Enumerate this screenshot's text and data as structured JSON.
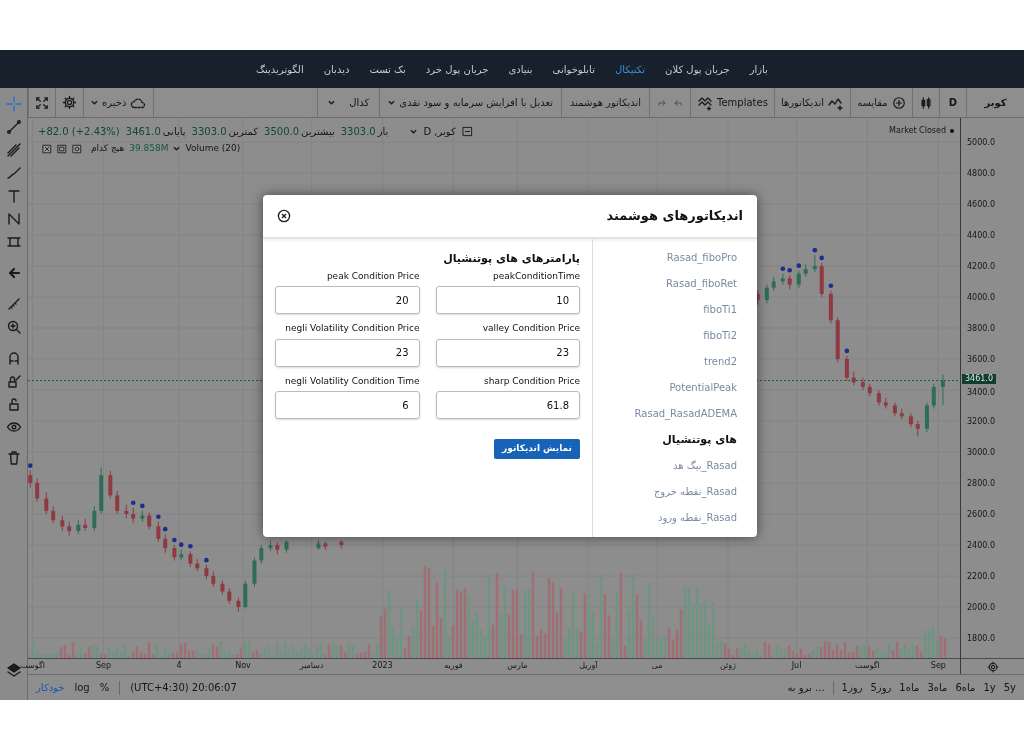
{
  "nav": [
    {
      "label": "بازار",
      "selected": false
    },
    {
      "label": "جریان پول کلان",
      "selected": false
    },
    {
      "label": "تکنیکال",
      "selected": true
    },
    {
      "label": "تابلوخوانی",
      "selected": false
    },
    {
      "label": "بنیادی",
      "selected": false
    },
    {
      "label": "جریان پول خرد",
      "selected": false
    },
    {
      "label": "بک تست",
      "selected": false
    },
    {
      "label": "دیدبان",
      "selected": false
    },
    {
      "label": "الگوتریدینگ",
      "selected": false
    }
  ],
  "tools": [
    {
      "kind": "crosshair",
      "selected": true
    },
    {
      "kind": "line",
      "selected": false
    },
    {
      "kind": "fork",
      "selected": false
    },
    {
      "kind": "brush",
      "selected": false
    },
    {
      "kind": "text",
      "selected": false
    },
    {
      "kind": "nodes",
      "selected": false
    },
    {
      "kind": "measure",
      "selected": false
    },
    {
      "kind": "arrow",
      "selected": false
    },
    {
      "kind": "ruler",
      "selected": false
    },
    {
      "kind": "zoom",
      "selected": false
    },
    {
      "kind": "magnet",
      "selected": false
    },
    {
      "kind": "lockpencil",
      "selected": false
    },
    {
      "kind": "lock",
      "selected": false
    },
    {
      "kind": "eye",
      "selected": false
    },
    {
      "kind": "trash",
      "selected": false
    }
  ],
  "toolbar": {
    "symbol": "کوبر",
    "interval": "D",
    "compare": "مقایسه",
    "indicators": "اندیکاتورها",
    "templates": "Templates",
    "smart_indicator": "اندیکاتور هوشمند",
    "adjustment": "تعدیل با افزایش سرمایه و سود نقدی",
    "codal": "کدال",
    "save": "ذخیره"
  },
  "legend": {
    "symbol": "کوبر, D",
    "stats": [
      {
        "label": "باز",
        "value": "3303.0"
      },
      {
        "label": "بیشترین",
        "value": "3500.0"
      },
      {
        "label": "کمترین",
        "value": "3303.0"
      },
      {
        "label": "پایانی",
        "value": "3461.0"
      }
    ],
    "change": "+82.0 (+2.43%)",
    "volume_label": "Volume (20)",
    "volume_value": "39.858M",
    "volume_ma": "هیچ کدام",
    "market_status": "Market Closed"
  },
  "chart_data": {
    "type": "candlestick",
    "grid": true,
    "x": [
      "2022-07-31",
      "2022-08-03",
      "2022-08-07",
      "2022-08-10",
      "2022-08-14",
      "2022-08-17",
      "2022-08-21",
      "2022-08-24",
      "2022-08-28",
      "2022-08-31",
      "2022-09-04",
      "2022-09-07",
      "2022-09-11",
      "2022-09-14",
      "2022-09-18",
      "2022-09-21",
      "2022-09-25",
      "2022-09-28",
      "2022-10-02",
      "2022-10-05",
      "2022-10-09",
      "2022-10-12",
      "2022-10-16",
      "2022-10-19",
      "2022-10-23",
      "2022-10-26",
      "2022-10-30",
      "2022-11-02",
      "2022-11-06",
      "2022-11-09",
      "2022-11-13",
      "2022-11-16",
      "2022-11-20",
      "2022-12-04",
      "2022-12-07",
      "2022-12-14",
      "2023-06-14",
      "2023-06-18",
      "2023-06-21",
      "2023-06-25",
      "2023-06-28",
      "2023-07-02",
      "2023-07-05",
      "2023-07-09",
      "2023-07-12",
      "2023-07-16",
      "2023-07-19",
      "2023-07-23",
      "2023-07-26",
      "2023-07-30",
      "2023-08-02",
      "2023-08-06",
      "2023-08-09",
      "2023-08-13",
      "2023-08-16",
      "2023-08-20",
      "2023-08-23",
      "2023-08-27",
      "2023-08-30",
      "2023-09-03"
    ],
    "ohlc": [
      [
        2850,
        2880,
        2770,
        2800
      ],
      [
        2800,
        2830,
        2680,
        2700
      ],
      [
        2700,
        2740,
        2600,
        2620
      ],
      [
        2620,
        2650,
        2540,
        2560
      ],
      [
        2560,
        2590,
        2490,
        2520
      ],
      [
        2520,
        2550,
        2460,
        2490
      ],
      [
        2490,
        2560,
        2470,
        2530
      ],
      [
        2530,
        2570,
        2490,
        2510
      ],
      [
        2510,
        2650,
        2490,
        2620
      ],
      [
        2620,
        2900,
        2600,
        2850
      ],
      [
        2850,
        2880,
        2700,
        2720
      ],
      [
        2720,
        2750,
        2600,
        2620
      ],
      [
        2620,
        2660,
        2570,
        2600
      ],
      [
        2600,
        2640,
        2540,
        2570
      ],
      [
        2570,
        2620,
        2550,
        2590
      ],
      [
        2590,
        2610,
        2500,
        2520
      ],
      [
        2520,
        2550,
        2420,
        2440
      ],
      [
        2440,
        2470,
        2350,
        2380
      ],
      [
        2380,
        2400,
        2300,
        2320
      ],
      [
        2320,
        2370,
        2300,
        2340
      ],
      [
        2340,
        2360,
        2260,
        2280
      ],
      [
        2280,
        2310,
        2230,
        2250
      ],
      [
        2250,
        2270,
        2180,
        2200
      ],
      [
        2200,
        2230,
        2130,
        2150
      ],
      [
        2150,
        2170,
        2080,
        2100
      ],
      [
        2100,
        2120,
        2020,
        2040
      ],
      [
        2040,
        2060,
        1970,
        2000
      ],
      [
        2000,
        2170,
        1990,
        2150
      ],
      [
        2150,
        2320,
        2130,
        2300
      ],
      [
        2300,
        2400,
        2280,
        2380
      ],
      [
        2380,
        2430,
        2360,
        2400
      ],
      [
        2400,
        2420,
        2340,
        2370
      ],
      [
        2370,
        2430,
        2350,
        2420
      ],
      [
        2380,
        2430,
        2370,
        2410
      ],
      [
        2410,
        2420,
        2370,
        2390
      ],
      [
        2420,
        2430,
        2380,
        2400
      ],
      [
        4020,
        4040,
        3950,
        3980
      ],
      [
        3980,
        4080,
        3960,
        4060
      ],
      [
        4060,
        4130,
        4040,
        4100
      ],
      [
        4100,
        4150,
        4080,
        4120
      ],
      [
        4120,
        4140,
        4050,
        4080
      ],
      [
        4080,
        4170,
        4060,
        4150
      ],
      [
        4150,
        4210,
        4130,
        4180
      ],
      [
        4180,
        4270,
        4160,
        4200
      ],
      [
        4200,
        4220,
        4000,
        4020
      ],
      [
        4020,
        4040,
        3830,
        3850
      ],
      [
        3850,
        3870,
        3580,
        3600
      ],
      [
        3600,
        3620,
        3460,
        3480
      ],
      [
        3480,
        3520,
        3430,
        3450
      ],
      [
        3450,
        3480,
        3400,
        3420
      ],
      [
        3420,
        3440,
        3360,
        3380
      ],
      [
        3380,
        3400,
        3300,
        3320
      ],
      [
        3320,
        3350,
        3280,
        3300
      ],
      [
        3300,
        3320,
        3230,
        3250
      ],
      [
        3250,
        3280,
        3210,
        3230
      ],
      [
        3230,
        3250,
        3160,
        3180
      ],
      [
        3180,
        3200,
        3100,
        3150
      ],
      [
        3150,
        3320,
        3130,
        3300
      ],
      [
        3300,
        3440,
        3280,
        3420
      ],
      [
        3420,
        3500,
        3303,
        3461
      ]
    ],
    "xlim": [
      "2022-07-30",
      "2023-10-08"
    ],
    "ylim": [
      1671,
      5155
    ],
    "xticks": [
      {
        "value": "2022-08-01",
        "label": "اگوست"
      },
      {
        "value": "2022-09-01",
        "label": "Sep"
      },
      {
        "value": "2022-10-04",
        "label": "4"
      },
      {
        "value": "2022-11-01",
        "label": "Nov"
      },
      {
        "value": "2022-12-01",
        "label": "دسامبر"
      },
      {
        "value": "2023-01-01",
        "label": "2023"
      },
      {
        "value": "2023-02-01",
        "label": "فوریه"
      },
      {
        "value": "2023-03-01",
        "label": "مارس"
      },
      {
        "value": "2023-04-01",
        "label": "آوریل"
      },
      {
        "value": "2023-05-01",
        "label": "می"
      },
      {
        "value": "2023-06-01",
        "label": "ژوئن"
      },
      {
        "value": "2023-07-01",
        "label": "Jul"
      },
      {
        "value": "2023-08-01",
        "label": "اگوست"
      },
      {
        "value": "2023-09-01",
        "label": "Sep"
      }
    ],
    "yticks": [
      {
        "value": 5000,
        "label": "5000.0"
      },
      {
        "value": 4800,
        "label": "4800.0"
      },
      {
        "value": 4600,
        "label": "4600.0"
      },
      {
        "value": 4400,
        "label": "4400.0"
      },
      {
        "value": 4200,
        "label": "4200.0"
      },
      {
        "value": 4000,
        "label": "4000.0"
      },
      {
        "value": 3800,
        "label": "3800.0"
      },
      {
        "value": 3600,
        "label": "3600.0"
      },
      {
        "value": 3400,
        "label": "3400.0"
      },
      {
        "value": 3200,
        "label": "3200.0"
      },
      {
        "value": 3000,
        "label": "3000.0"
      },
      {
        "value": 2800,
        "label": "2800.0"
      },
      {
        "value": 2600,
        "label": "2600.0"
      },
      {
        "value": 2400,
        "label": "2400.0"
      },
      {
        "value": 2200,
        "label": "2200.0"
      },
      {
        "value": 2000,
        "label": "2000.0"
      },
      {
        "value": 1800,
        "label": "1800.0"
      }
    ],
    "ref_lines": [
      {
        "axis": "y",
        "value": 3461,
        "label": "3461.0"
      }
    ]
  },
  "bottom_bar": {
    "options": [
      {
        "label": "%",
        "selected": false
      },
      {
        "label": "log",
        "selected": false
      },
      {
        "label": "خودکار",
        "selected": true
      }
    ],
    "clock": "(UTC+4:30) 20:06:07",
    "goto": "برو به ...",
    "ranges": [
      "5y",
      "1y",
      "6ماه",
      "3ماه",
      "1ماه",
      "5روز",
      "1روز"
    ]
  },
  "modal": {
    "title": "اندیکاتورهای هوشمند",
    "list": [
      {
        "kind": "item",
        "label": "Rasad_fiboPro"
      },
      {
        "kind": "item",
        "label": "Rasad_fiboRet"
      },
      {
        "kind": "item",
        "label": "fiboTi1"
      },
      {
        "kind": "item",
        "label": "fiboTi2"
      },
      {
        "kind": "item",
        "label": "trend2"
      },
      {
        "kind": "item",
        "label": "PotentialPeak"
      },
      {
        "kind": "item",
        "label": "Rasad_RasadADEMA"
      },
      {
        "kind": "heading",
        "label": "های پوتنشیال"
      },
      {
        "kind": "item",
        "label": "Rasad_بیگ هد"
      },
      {
        "kind": "item",
        "label": "Rasad_نقطه خروج"
      },
      {
        "kind": "item",
        "label": "Rasad_نقطه ورود"
      }
    ],
    "form_title": "پارامترهای های پوتنشیال",
    "fields": [
      {
        "label": "peakConditionTime",
        "value": "10"
      },
      {
        "label": "peak Condition Price",
        "value": "20"
      },
      {
        "label": "valley Condition Price",
        "value": "23"
      },
      {
        "label": "negli Volatility Condition Price",
        "value": "23"
      },
      {
        "label": "sharp Condition Price",
        "value": "61.8"
      },
      {
        "label": "negli Volatility Condition Time",
        "value": "6"
      }
    ],
    "button": "نمایش اندیکاتور"
  }
}
